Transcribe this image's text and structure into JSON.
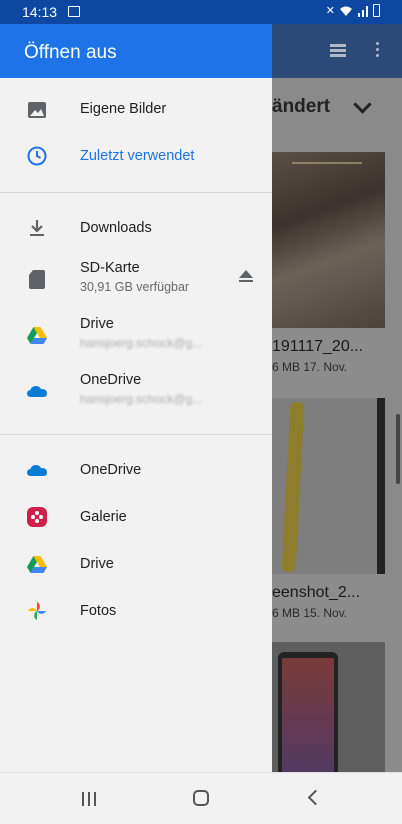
{
  "status_bar": {
    "time": "14:13"
  },
  "drawer": {
    "title": "Öffnen aus",
    "section1": [
      {
        "label": "Eigene Bilder",
        "icon": "image-icon"
      },
      {
        "label": "Zuletzt verwendet",
        "icon": "clock-icon",
        "active": true
      }
    ],
    "section2": [
      {
        "label": "Downloads",
        "icon": "download-icon"
      },
      {
        "label": "SD-Karte",
        "sub": "30,91 GB verfügbar",
        "icon": "sd-card-icon",
        "action_icon": "eject-icon"
      },
      {
        "label": "Drive",
        "sub": "hansjoerg.schock@g...",
        "icon": "google-drive-icon"
      },
      {
        "label": "OneDrive",
        "sub": "hansjoerg.schock@g...",
        "icon": "onedrive-icon"
      }
    ],
    "section3": [
      {
        "label": "OneDrive",
        "icon": "onedrive-icon"
      },
      {
        "label": "Galerie",
        "icon": "gallery-icon"
      },
      {
        "label": "Drive",
        "icon": "google-drive-icon"
      },
      {
        "label": "Fotos",
        "icon": "google-photos-icon"
      }
    ]
  },
  "background": {
    "sort_label": "ändert",
    "cards": [
      {
        "name": "191117_20...",
        "meta": "6 MB 17. Nov."
      },
      {
        "name": "eenshot_2...",
        "meta": "6 MB 15. Nov."
      }
    ]
  },
  "colors": {
    "accent": "#1e73e8",
    "status_bar": "#0d47a1",
    "drawer_bg": "#f2f2f2"
  }
}
